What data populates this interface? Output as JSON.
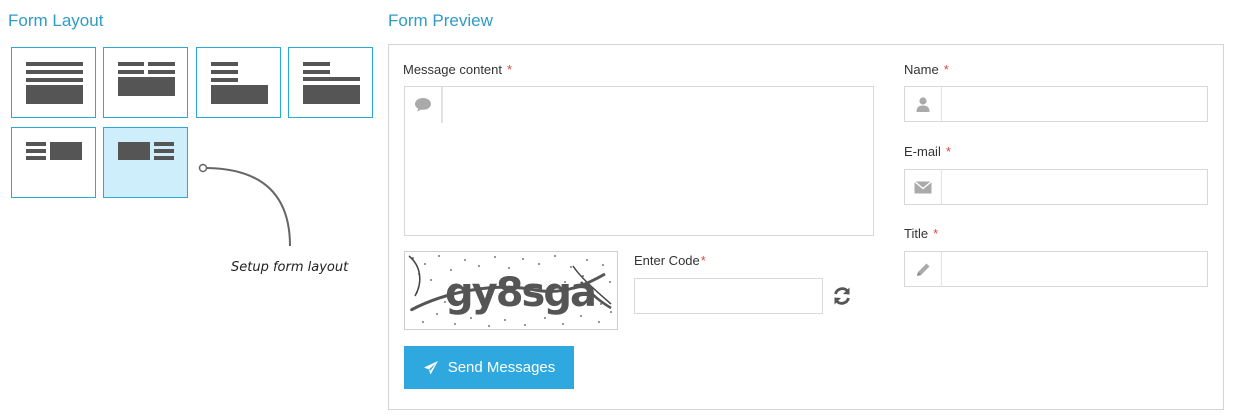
{
  "form_layout": {
    "title": "Form Layout",
    "options": [
      {
        "id": "layout-1",
        "selected": false
      },
      {
        "id": "layout-2",
        "selected": false
      },
      {
        "id": "layout-3",
        "selected": false
      },
      {
        "id": "layout-4",
        "selected": false
      },
      {
        "id": "layout-5",
        "selected": false
      },
      {
        "id": "layout-6",
        "selected": true
      }
    ],
    "annotation": "Setup form layout"
  },
  "form_preview": {
    "title": "Form Preview",
    "message": {
      "label": "Message content",
      "required_mark": "*",
      "icon": "comment-icon",
      "value": ""
    },
    "captcha": {
      "image_text": "gy8sga",
      "code_label": "Enter Code",
      "required_mark": "*",
      "code_value": "",
      "refresh_icon": "refresh-icon"
    },
    "name": {
      "label": "Name",
      "required_mark": "*",
      "icon": "user-icon",
      "value": ""
    },
    "email": {
      "label": "E-mail",
      "required_mark": "*",
      "icon": "envelope-icon",
      "value": ""
    },
    "title_field": {
      "label": "Title",
      "required_mark": "*",
      "icon": "pencil-icon",
      "value": ""
    },
    "send_button": {
      "label": "Send Messages",
      "icon": "paper-plane-icon"
    }
  },
  "colors": {
    "accent": "#2ea8de",
    "heading": "#2f9bc7",
    "required": "#e0473e",
    "selected_bg": "#cfeefc",
    "icon_gray": "#555555"
  }
}
